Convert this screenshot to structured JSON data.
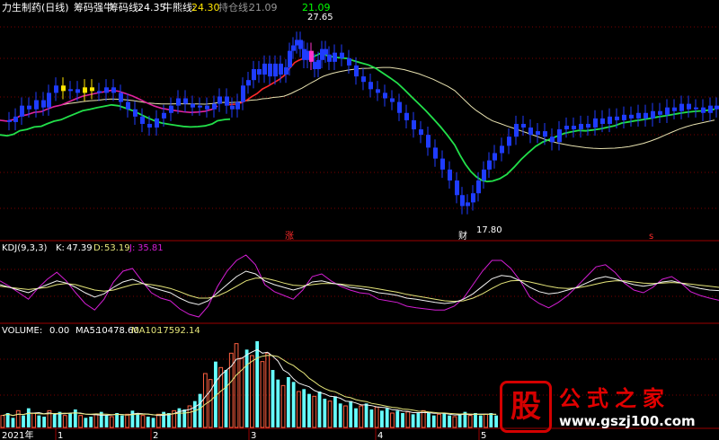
{
  "colors": {
    "bg": "#000000",
    "grid": "#7a0000",
    "separator": "#9b0000",
    "up_yellow": "#ffe600",
    "up_magenta": "#ff33cc",
    "down_blue": "#1f3cff",
    "ma_green": "#22e04a",
    "ma_magenta": "#e0239f",
    "ma_red": "#ff2a2a",
    "ma_pale": "#e8e2b0",
    "kdj_k": "#f2f2f2",
    "kdj_d": "#e6e67a",
    "kdj_j": "#d41ed4",
    "vol_up_outline": "#ff6040",
    "vol_down": "#66ffff",
    "text_white": "#ffffff",
    "text_green": "#00ff00"
  },
  "header": {
    "name": "力生制药(日线)",
    "ind1": "筹码强牛",
    "ind2_label": "筹码线:",
    "ind2_value": "24.35",
    "ind3_label": "牛熊线:",
    "ind3_value": "24.30",
    "ind4_label": "持仓线:",
    "ind4_value": "21.09",
    "top_value": "21.09"
  },
  "price_panel": {
    "high_label": "27.65",
    "low_label": "17.80",
    "marker_up": "涨",
    "marker_cai": "财",
    "marker_s": "s"
  },
  "kdj": {
    "label": "KDJ(9,3,3)",
    "k_label": "K:",
    "k_value": "47.39",
    "d_label": "D:",
    "d_value": "53.19",
    "j_label": "J:",
    "j_value": "35.81"
  },
  "volume": {
    "label": "VOLUME:",
    "value": "0.00",
    "ma5_label": "MA5:",
    "ma5_value": "10478.60",
    "ma10_label": "MA10:",
    "ma10_value": "17592.14"
  },
  "x_axis": {
    "ticks": [
      "2021年",
      "1",
      "2",
      "3",
      "4",
      "5"
    ]
  },
  "watermark": {
    "logo": "股",
    "title": "公式之家",
    "url": "www.gszj100.com"
  },
  "chart_data": {
    "type": "candlestick",
    "price_range": [
      16.5,
      28.5
    ],
    "ohlc_close_path": [
      [
        0,
        22.8
      ],
      [
        8,
        22.7
      ],
      [
        15,
        23.0
      ],
      [
        22,
        23.6
      ],
      [
        30,
        23.4
      ],
      [
        38,
        23.9
      ],
      [
        46,
        23.5
      ],
      [
        52,
        24.3
      ],
      [
        60,
        24.7
      ],
      [
        68,
        24.4
      ],
      [
        76,
        24.5
      ],
      [
        84,
        24.3
      ],
      [
        92,
        24.6
      ],
      [
        100,
        24.4
      ],
      [
        108,
        24.3
      ],
      [
        116,
        24.6
      ],
      [
        124,
        24.3
      ],
      [
        132,
        23.8
      ],
      [
        140,
        23.4
      ],
      [
        148,
        23.0
      ],
      [
        156,
        22.6
      ],
      [
        164,
        22.4
      ],
      [
        172,
        22.9
      ],
      [
        180,
        23.2
      ],
      [
        188,
        23.6
      ],
      [
        196,
        24.0
      ],
      [
        204,
        23.7
      ],
      [
        212,
        23.5
      ],
      [
        220,
        23.6
      ],
      [
        228,
        23.4
      ],
      [
        236,
        23.7
      ],
      [
        242,
        24.1
      ],
      [
        250,
        23.6
      ],
      [
        256,
        23.4
      ],
      [
        262,
        23.8
      ],
      [
        268,
        24.7
      ],
      [
        274,
        25.0
      ],
      [
        280,
        25.6
      ],
      [
        286,
        25.3
      ],
      [
        292,
        25.9
      ],
      [
        298,
        25.2
      ],
      [
        304,
        25.9
      ],
      [
        310,
        25.3
      ],
      [
        316,
        25.7
      ],
      [
        320,
        26.6
      ],
      [
        324,
        26.9
      ],
      [
        328,
        27.2
      ],
      [
        332,
        26.7
      ],
      [
        336,
        26.1
      ],
      [
        340,
        26.6
      ],
      [
        344,
        26.0
      ],
      [
        348,
        25.6
      ],
      [
        352,
        26.1
      ],
      [
        356,
        26.7
      ],
      [
        360,
        26.4
      ],
      [
        364,
        26.0
      ],
      [
        370,
        26.5
      ],
      [
        378,
        26.2
      ],
      [
        386,
        25.8
      ],
      [
        394,
        25.2
      ],
      [
        402,
        24.9
      ],
      [
        410,
        24.5
      ],
      [
        418,
        24.3
      ],
      [
        426,
        24.0
      ],
      [
        434,
        23.8
      ],
      [
        442,
        23.2
      ],
      [
        450,
        22.8
      ],
      [
        458,
        22.3
      ],
      [
        466,
        22.0
      ],
      [
        474,
        21.3
      ],
      [
        482,
        20.7
      ],
      [
        490,
        20.1
      ],
      [
        498,
        19.5
      ],
      [
        506,
        18.7
      ],
      [
        512,
        18.1
      ],
      [
        518,
        18.3
      ],
      [
        524,
        18.8
      ],
      [
        530,
        19.5
      ],
      [
        536,
        20.1
      ],
      [
        542,
        20.6
      ],
      [
        548,
        21.0
      ],
      [
        556,
        21.4
      ],
      [
        564,
        21.9
      ],
      [
        572,
        22.6
      ],
      [
        580,
        22.4
      ],
      [
        588,
        22.0
      ],
      [
        596,
        22.2
      ],
      [
        604,
        21.9
      ],
      [
        612,
        21.6
      ],
      [
        620,
        22.3
      ],
      [
        628,
        22.5
      ],
      [
        636,
        22.3
      ],
      [
        644,
        22.6
      ],
      [
        652,
        22.4
      ],
      [
        660,
        22.9
      ],
      [
        668,
        22.6
      ],
      [
        676,
        23.0
      ],
      [
        684,
        22.8
      ],
      [
        692,
        23.1
      ],
      [
        700,
        22.9
      ],
      [
        708,
        23.2
      ],
      [
        716,
        22.9
      ],
      [
        724,
        23.3
      ],
      [
        732,
        23.1
      ],
      [
        740,
        23.5
      ],
      [
        748,
        23.3
      ],
      [
        756,
        23.7
      ],
      [
        764,
        23.4
      ],
      [
        772,
        23.5
      ],
      [
        780,
        23.2
      ],
      [
        788,
        23.6
      ],
      [
        795,
        23.4
      ]
    ],
    "highlight_yellow_x": [
      56,
      62,
      68,
      74,
      92,
      100,
      118,
      240,
      270,
      284,
      296,
      306,
      318,
      326,
      334,
      358
    ],
    "highlight_magenta_x": [
      338,
      344
    ],
    "kdj_k": [
      55,
      50,
      45,
      40,
      48,
      55,
      62,
      58,
      50,
      40,
      32,
      38,
      50,
      60,
      65,
      58,
      50,
      45,
      40,
      30,
      22,
      18,
      25,
      40,
      55,
      70,
      80,
      75,
      62,
      55,
      50,
      45,
      50,
      60,
      62,
      58,
      55,
      50,
      48,
      45,
      40,
      38,
      35,
      30,
      28,
      25,
      22,
      20,
      22,
      28,
      38,
      52,
      66,
      72,
      70,
      62,
      50,
      42,
      38,
      40,
      45,
      50,
      58,
      66,
      70,
      66,
      60,
      55,
      52,
      55,
      60,
      62,
      58,
      52,
      48,
      45,
      44
    ],
    "kdj_d": [
      52,
      50,
      48,
      46,
      48,
      50,
      55,
      57,
      55,
      50,
      45,
      43,
      45,
      50,
      55,
      57,
      55,
      52,
      48,
      42,
      35,
      30,
      30,
      34,
      42,
      52,
      62,
      67,
      67,
      63,
      58,
      54,
      53,
      55,
      57,
      57,
      56,
      54,
      52,
      50,
      47,
      44,
      41,
      37,
      34,
      31,
      28,
      25,
      24,
      25,
      30,
      38,
      48,
      57,
      62,
      63,
      60,
      56,
      52,
      49,
      48,
      49,
      52,
      56,
      60,
      62,
      62,
      60,
      58,
      57,
      58,
      59,
      58,
      56,
      54,
      52,
      50
    ],
    "kdj_j": [
      62,
      52,
      40,
      28,
      48,
      65,
      78,
      62,
      40,
      20,
      8,
      28,
      60,
      80,
      85,
      62,
      40,
      30,
      25,
      10,
      0,
      -5,
      15,
      52,
      80,
      100,
      110,
      92,
      55,
      42,
      35,
      28,
      45,
      70,
      75,
      62,
      52,
      45,
      40,
      38,
      28,
      25,
      22,
      15,
      12,
      10,
      8,
      8,
      15,
      30,
      55,
      80,
      100,
      100,
      85,
      62,
      32,
      20,
      12,
      22,
      35,
      52,
      70,
      88,
      92,
      78,
      58,
      45,
      40,
      50,
      65,
      70,
      58,
      42,
      35,
      30,
      26
    ],
    "volume": [
      10,
      12,
      8,
      14,
      10,
      16,
      12,
      10,
      9,
      14,
      11,
      13,
      10,
      12,
      15,
      10,
      8,
      9,
      11,
      13,
      10,
      9,
      12,
      10,
      11,
      14,
      12,
      10,
      9,
      8,
      11,
      13,
      12,
      14,
      16,
      15,
      18,
      22,
      28,
      45,
      40,
      55,
      50,
      48,
      62,
      70,
      58,
      65,
      60,
      72,
      55,
      62,
      48,
      40,
      35,
      42,
      38,
      30,
      32,
      28,
      26,
      30,
      24,
      22,
      26,
      20,
      18,
      22,
      16,
      18,
      20,
      15,
      17,
      14,
      16,
      12,
      14,
      12,
      13,
      11,
      12,
      14,
      12,
      10,
      11,
      12,
      10,
      9,
      11,
      13,
      10,
      12,
      10,
      11,
      12,
      10
    ]
  }
}
